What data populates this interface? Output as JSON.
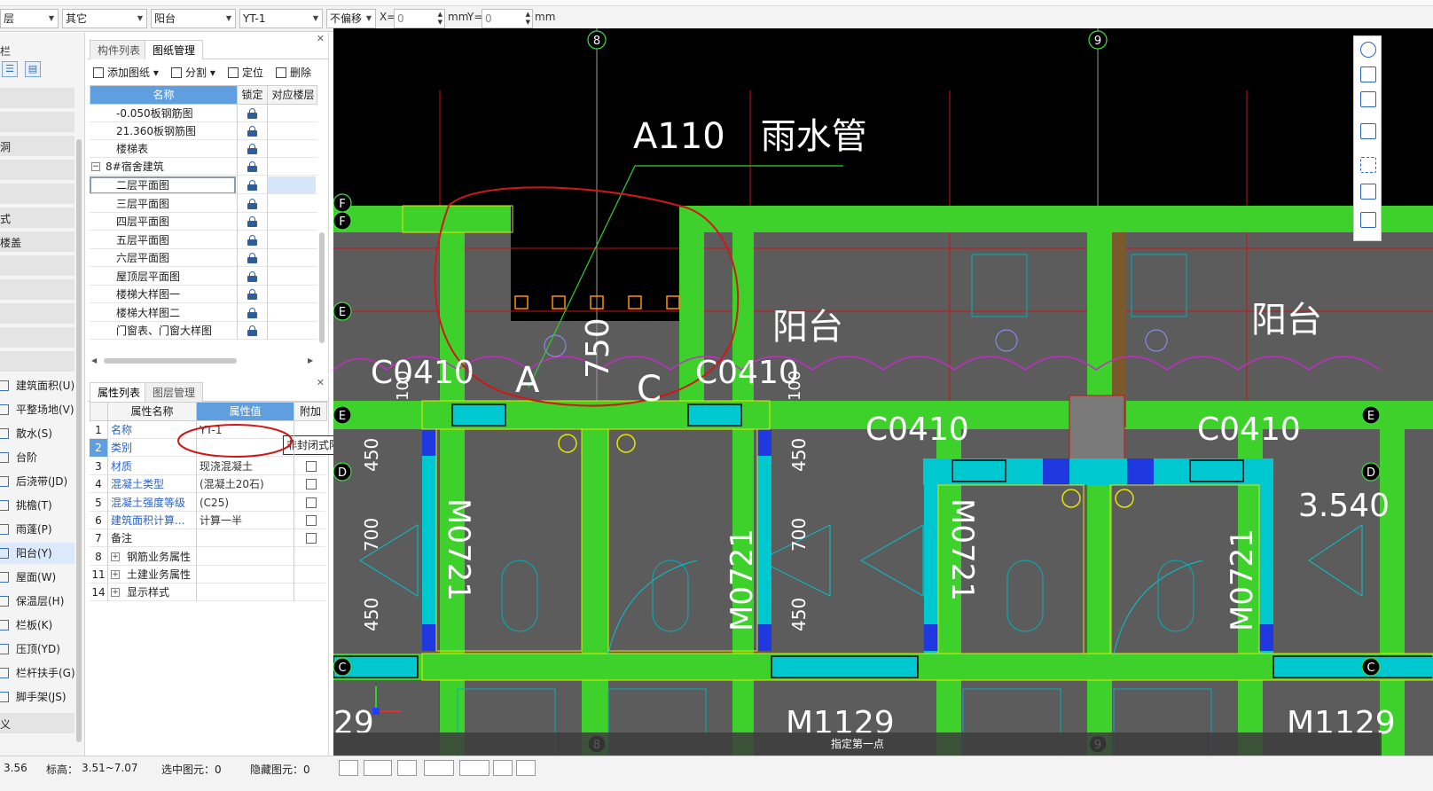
{
  "toolbar": {
    "floor_select": "层",
    "category_select": "其它",
    "type_select": "阳台",
    "component_select": "YT-1",
    "offset_select": "不偏移",
    "x_label": "X=",
    "x_value": "0",
    "mm1": "mm",
    "y_label": "Y=",
    "y_value": "0",
    "mm2": "mm"
  },
  "leftnav": {
    "title": "栏",
    "frag_labels": [
      "洞",
      "式",
      "楼盖"
    ],
    "items": [
      {
        "label": "建筑面积(U)"
      },
      {
        "label": "平整场地(V)"
      },
      {
        "label": "散水(S)"
      },
      {
        "label": "台阶"
      },
      {
        "label": "后浇带(JD)"
      },
      {
        "label": "挑檐(T)"
      },
      {
        "label": "雨蓬(P)"
      },
      {
        "label": "阳台(Y)"
      },
      {
        "label": "屋面(W)"
      },
      {
        "label": "保温层(H)"
      },
      {
        "label": "栏板(K)"
      },
      {
        "label": "压顶(YD)"
      },
      {
        "label": "栏杆扶手(G)"
      },
      {
        "label": "脚手架(JS)"
      }
    ],
    "bottom_label": "义"
  },
  "drawpanel": {
    "tab_components": "构件列表",
    "tab_drawings": "图纸管理",
    "add_drawing": "添加图纸",
    "split": "分割",
    "locate": "定位",
    "delete": "删除",
    "col_name": "名称",
    "col_lock": "锁定",
    "col_floor": "对应楼层",
    "rows": [
      {
        "name": "-0.050板钢筋图"
      },
      {
        "name": "21.360板钢筋图"
      },
      {
        "name": "楼梯表"
      },
      {
        "name": "8#宿舍建筑"
      },
      {
        "name": "二层平面图"
      },
      {
        "name": "三层平面图"
      },
      {
        "name": "四层平面图"
      },
      {
        "name": "五层平面图"
      },
      {
        "name": "六层平面图"
      },
      {
        "name": "屋顶层平面图"
      },
      {
        "name": "楼梯大样图一"
      },
      {
        "name": "楼梯大样图二"
      },
      {
        "name": "门窗表、门窗大样图"
      }
    ]
  },
  "proppanel": {
    "tab_props": "属性列表",
    "tab_layers": "图层管理",
    "col_name": "属性名称",
    "col_value": "属性值",
    "col_extra": "附加",
    "rows": [
      {
        "no": "1",
        "name": "名称",
        "value": "YT-1"
      },
      {
        "no": "2",
        "name": "类别",
        "value": "非封闭式阳台"
      },
      {
        "no": "3",
        "name": "材质",
        "value": "现浇混凝土"
      },
      {
        "no": "4",
        "name": "混凝土类型",
        "value": "(混凝土20石)"
      },
      {
        "no": "5",
        "name": "混凝土强度等级",
        "value": "(C25)"
      },
      {
        "no": "6",
        "name": "建筑面积计算...",
        "value": "计算一半"
      },
      {
        "no": "7",
        "name": "备注",
        "value": ""
      }
    ],
    "groups": [
      {
        "no": "8",
        "name": "钢筋业务属性"
      },
      {
        "no": "11",
        "name": "土建业务属性"
      },
      {
        "no": "14",
        "name": "显示样式"
      }
    ]
  },
  "canvas": {
    "axis_top": [
      "8",
      "9"
    ],
    "axis_left": [
      "F",
      "F",
      "E",
      "E",
      "D",
      "C"
    ],
    "axis_right": [
      "D",
      "C",
      "E"
    ],
    "annotation_main": "A110　雨水管",
    "text_balcony": "阳台",
    "window_label": "C0410",
    "door_label": "M0721",
    "door_label_bottom": "M1129",
    "dim_100": "100",
    "dim_450": "450",
    "dim_700": "700",
    "dim_750": "750",
    "letter_a": "A",
    "letter_c": "C",
    "elev": "3.540",
    "left_num": "29",
    "hint": "指定第一点"
  },
  "status": {
    "coord": "3.56",
    "elev_label": "标高：",
    "elev_value": "3.51~7.07",
    "selected": "选中图元：0",
    "hidden": "隐藏图元：0"
  },
  "colors": {
    "wall_green": "#3ed12c",
    "canvas_bg": "#000000",
    "floor_gray": "#5c5c5c",
    "redline": "#d01818",
    "accent_blue": "#5f9fe0"
  }
}
